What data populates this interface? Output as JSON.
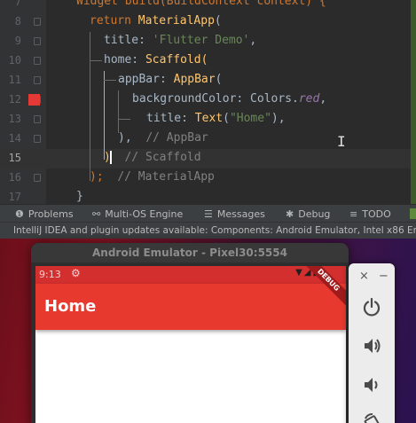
{
  "editor": {
    "top_partial": "Widget build(BuildContext context) {",
    "lines": [
      {
        "num": "8",
        "tokens": [
          [
            "kw",
            "return "
          ],
          [
            "fn",
            "MaterialApp"
          ],
          [
            "cls",
            "("
          ]
        ]
      },
      {
        "num": "9",
        "tokens": [
          [
            "cls",
            "title: "
          ],
          [
            "str",
            "'Flutter Demo'"
          ],
          [
            "cls",
            ","
          ]
        ]
      },
      {
        "num": "10",
        "tokens": [
          [
            "cls",
            "home: "
          ],
          [
            "fn",
            "Scaffold"
          ],
          [
            "fn",
            "("
          ]
        ]
      },
      {
        "num": "11",
        "tokens": [
          [
            "cls",
            "appBar: "
          ],
          [
            "fn",
            "AppBar"
          ],
          [
            "cls",
            "("
          ]
        ]
      },
      {
        "num": "12",
        "tokens": [
          [
            "cls",
            "backgroundColor: Colors."
          ],
          [
            "ital",
            "red"
          ],
          [
            "cls",
            ","
          ]
        ]
      },
      {
        "num": "13",
        "tokens": [
          [
            "cls",
            "title: "
          ],
          [
            "fn",
            "Text"
          ],
          [
            "cls",
            "("
          ],
          [
            "str",
            "\"Home\""
          ],
          [
            "cls",
            "),"
          ]
        ]
      },
      {
        "num": "14",
        "tokens": [
          [
            "cls",
            "),  "
          ],
          [
            "cmt",
            "// AppBar"
          ]
        ]
      },
      {
        "num": "15",
        "tokens": [
          [
            "fn",
            ")"
          ],
          [
            "cls",
            "  "
          ],
          [
            "cmt",
            "// Scaffold"
          ]
        ]
      },
      {
        "num": "16",
        "tokens": [
          [
            "kw",
            ");"
          ],
          [
            "cls",
            "  "
          ],
          [
            "cmt",
            "// MaterialApp"
          ]
        ]
      },
      {
        "num": "17",
        "tokens": [
          [
            "cls",
            "}"
          ]
        ]
      }
    ],
    "active_line": "15",
    "swatch_color": "#e53935"
  },
  "toolbar": {
    "tabs": [
      {
        "icon": "play-bug-icon",
        "glyph": "⚙",
        "label": "Problems"
      },
      {
        "icon": "multi-os-icon",
        "glyph": "⚯",
        "label": "Multi-OS Engine"
      },
      {
        "icon": "messages-icon",
        "glyph": "☰",
        "label": "Messages"
      },
      {
        "icon": "debug-icon",
        "glyph": "✱",
        "label": "Debug"
      },
      {
        "icon": "todo-icon",
        "glyph": "≡",
        "label": "TODO"
      }
    ]
  },
  "statusbar": {
    "text": "IntelliJ IDEA and plugin updates available: Components: Android Emulator, Intel x86 Em"
  },
  "emulator": {
    "title": "Android Emulator - Pixel30:5554",
    "time": "9:13",
    "appbar_title": "Home",
    "debug_banner": "DEBUG",
    "appbar_color": "#e8392f"
  },
  "side_panel": {
    "close": "×",
    "minimize": "−",
    "buttons": [
      "power-icon",
      "volume-up-icon",
      "volume-down-icon",
      "rotate-icon"
    ]
  }
}
